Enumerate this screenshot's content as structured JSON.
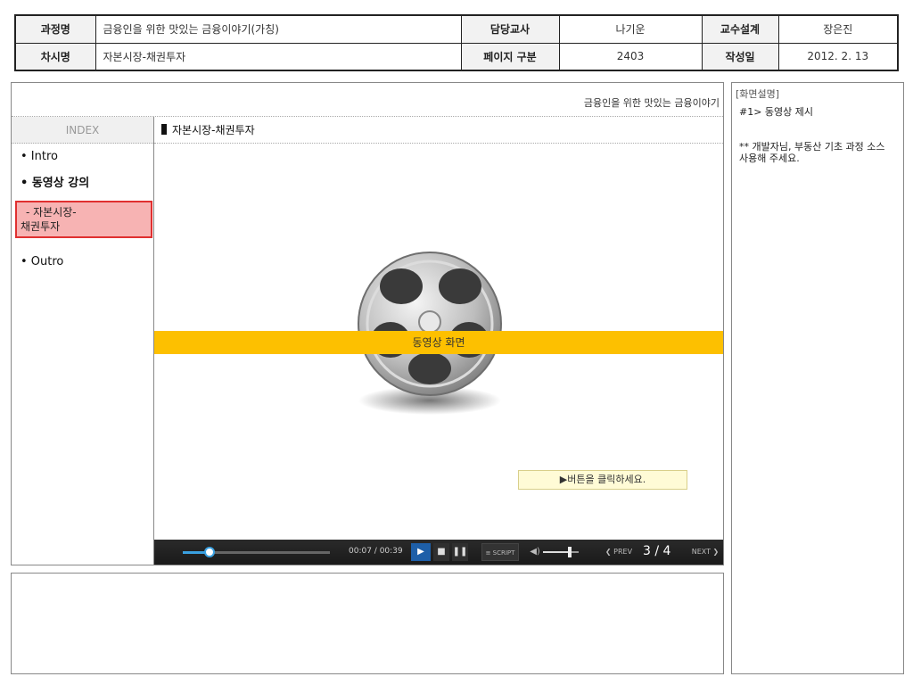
{
  "header": {
    "course_label": "과정명",
    "course_value": "금융인을 위한 맛있는 금융이야기(가칭)",
    "teacher_label": "담당교사",
    "teacher_value": "나기운",
    "design_label": "교수설계",
    "design_value": "장은진",
    "session_label": "차시명",
    "session_value": "자본시장-채권투자",
    "page_label": "페이지 구분",
    "page_value": "2403",
    "date_label": "작성일",
    "date_value": "2012. 2. 13"
  },
  "main": {
    "course_title": "금융인을 위한 맛있는 금융이야기",
    "content_heading": "자본시장-채권투자",
    "video_placeholder": "동영상 화면",
    "callout": "▶버튼을 클릭하세요."
  },
  "sidebar": {
    "index_label": "INDEX",
    "items": [
      {
        "label": "• Intro"
      },
      {
        "label": "• 동영상 강의"
      },
      {
        "label": "- 자본시장-"
      },
      {
        "label": "채권투자"
      },
      {
        "label": "• Outro"
      }
    ]
  },
  "player": {
    "progress_fraction": 0.18,
    "time": "00:07 / 00:39",
    "script_label": "≡ SCRIPT",
    "volume_fraction": 0.75,
    "prev_label": "❮ PREV",
    "page": "3 / 4",
    "next_label": "NEXT ❯"
  },
  "description": {
    "title": "[화면설명]",
    "line1": "#1> 동영상 제시",
    "line2": "** 개발자님, 부동산 기초 과정 소스 사용해 주세요."
  },
  "colors": {
    "highlight_fill": "#f7b3b3",
    "highlight_border": "#e03030",
    "orange_band": "#fdc000",
    "callout_fill": "#fffbd6"
  }
}
